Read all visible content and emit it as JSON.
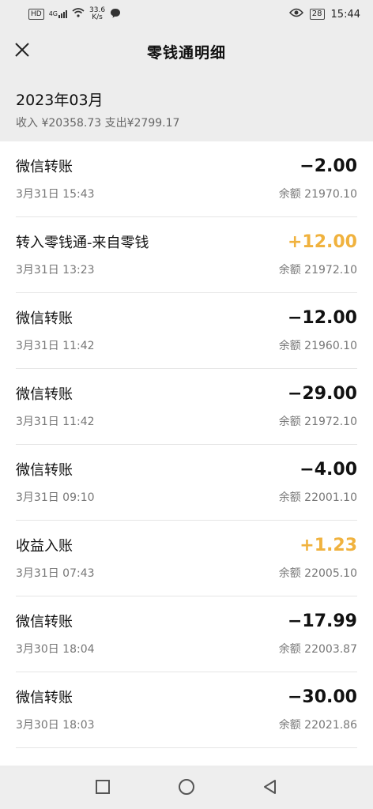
{
  "status_bar": {
    "hd": "HD",
    "signal": "4G",
    "speed_value": "33.6",
    "speed_unit": "K/s",
    "battery": "28",
    "time": "15:44"
  },
  "header": {
    "title": "零钱通明细"
  },
  "month": {
    "label": "2023年03月",
    "summary": "收入 ¥20358.73 支出¥2799.17"
  },
  "transactions": [
    {
      "name": "微信转账",
      "amount": "−2.00",
      "type": "neg",
      "time": "3月31日 15:43",
      "balance": "余额 21970.10"
    },
    {
      "name": "转入零钱通-来自零钱",
      "amount": "+12.00",
      "type": "pos",
      "time": "3月31日 13:23",
      "balance": "余额 21972.10"
    },
    {
      "name": "微信转账",
      "amount": "−12.00",
      "type": "neg",
      "time": "3月31日 11:42",
      "balance": "余额 21960.10"
    },
    {
      "name": "微信转账",
      "amount": "−29.00",
      "type": "neg",
      "time": "3月31日 11:42",
      "balance": "余额 21972.10"
    },
    {
      "name": "微信转账",
      "amount": "−4.00",
      "type": "neg",
      "time": "3月31日 09:10",
      "balance": "余额 22001.10"
    },
    {
      "name": "收益入账",
      "amount": "+1.23",
      "type": "pos",
      "time": "3月31日 07:43",
      "balance": "余额 22005.10"
    },
    {
      "name": "微信转账",
      "amount": "−17.99",
      "type": "neg",
      "time": "3月30日 18:04",
      "balance": "余额 22003.87"
    },
    {
      "name": "微信转账",
      "amount": "−30.00",
      "type": "neg",
      "time": "3月30日 18:03",
      "balance": "余额 22021.86"
    }
  ],
  "colors": {
    "positive_amount": "#f0b23e",
    "negative_amount": "#111111"
  },
  "icons": {
    "close": "close-icon",
    "nav_recent": "square-icon",
    "nav_home": "circle-icon",
    "nav_back": "triangle-back-icon"
  }
}
